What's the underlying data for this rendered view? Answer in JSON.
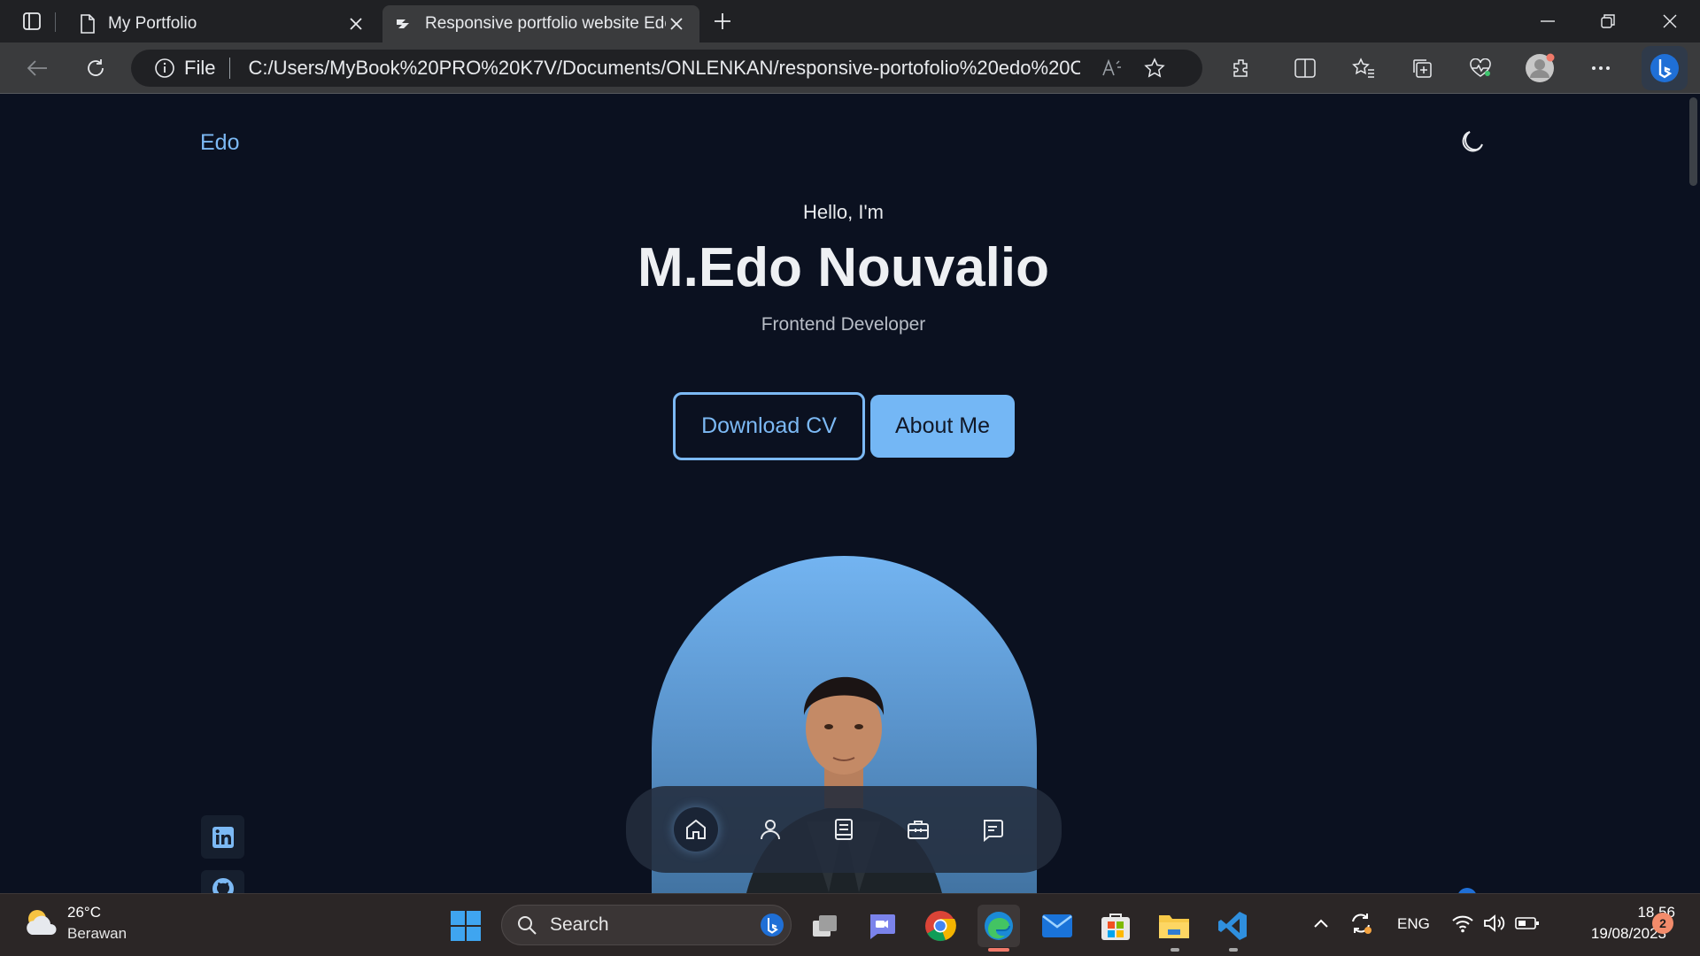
{
  "browser": {
    "tabs": [
      {
        "title": "My Portfolio",
        "active": false
      },
      {
        "title": "Responsive portfolio website Edo",
        "active": true
      }
    ],
    "address": {
      "scheme_label": "File",
      "url": "C:/Users/MyBook%20PRO%20K7V/Documents/ONLENKAN/responsive-portofolio%20edo%20ONLE..."
    }
  },
  "page": {
    "logo": "Edo",
    "greeting": "Hello, I'm",
    "name": "M.Edo Nouvalio",
    "role": "Frontend Developer",
    "buttons": {
      "download_cv": "Download CV",
      "about_me": "About Me"
    },
    "dock": {
      "items": [
        "home-icon",
        "user-icon",
        "book-icon",
        "briefcase-icon",
        "message-icon"
      ],
      "active": "home-icon"
    },
    "social": [
      "linkedin-icon",
      "github-icon"
    ],
    "colors": {
      "background": "#0b1120",
      "accent": "#7cb9f4"
    }
  },
  "taskbar": {
    "weather": {
      "temp": "26°C",
      "desc": "Berawan"
    },
    "search_placeholder": "Search",
    "language": "ENG",
    "time": "18.56",
    "date": "19/08/2023",
    "notification_count": "2"
  }
}
